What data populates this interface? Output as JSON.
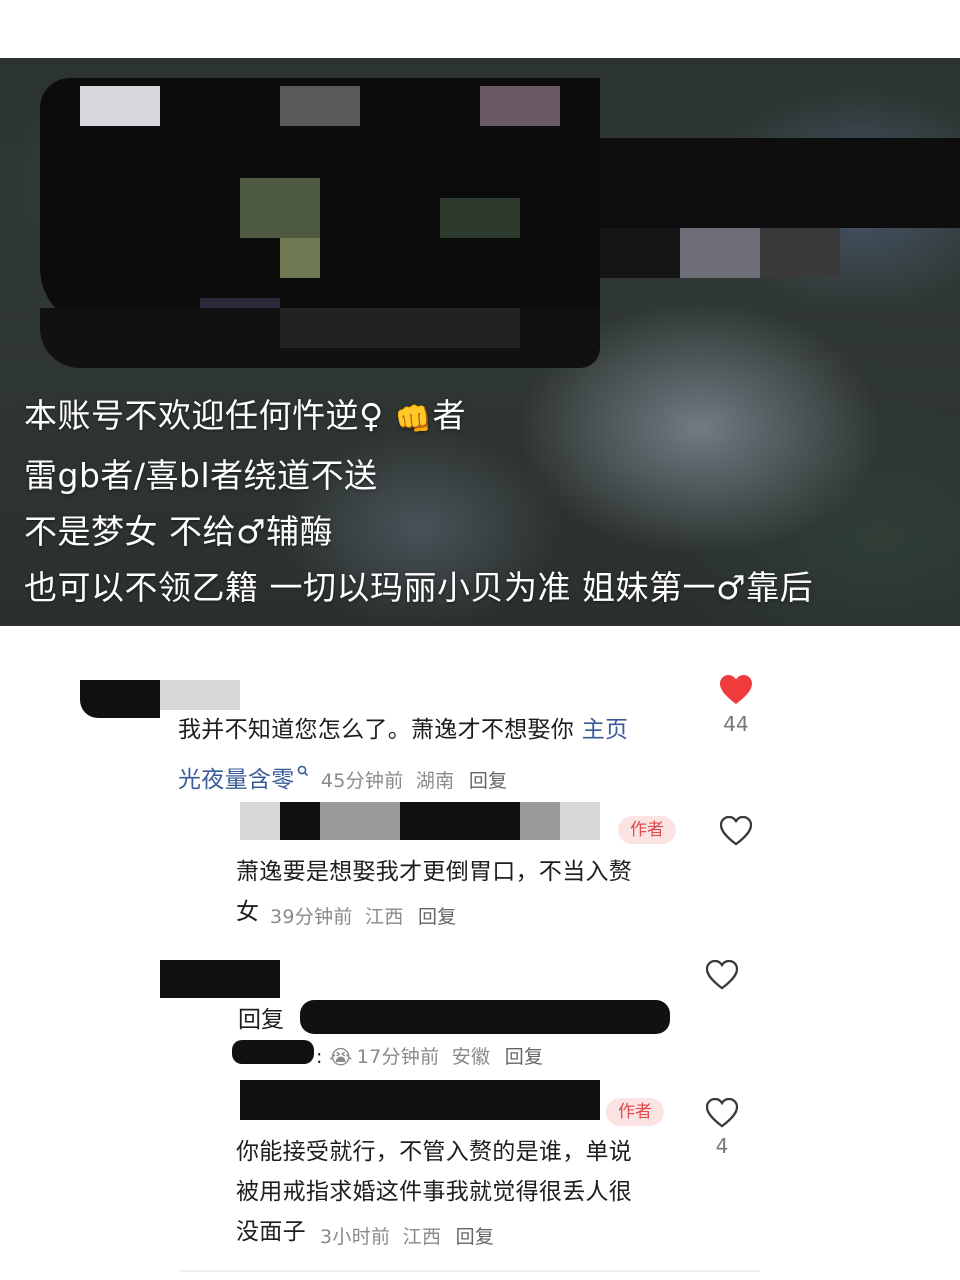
{
  "banner": {
    "lines": [
      "本账号不欢迎任何忤逆♀",
      "者",
      "雷gb者/喜bl者绕道不送",
      "不是梦女 不给♂辅酶",
      "也可以不领乙籍 一切以玛丽小贝为准 姐妹第一♂靠后"
    ],
    "fist_icon": "fist-emoji",
    "fist_glyph": "👊"
  },
  "comments": [
    {
      "text": "我并不知道您怎么了。萧逸才不想娶你 ",
      "link_text": "主页",
      "link_tail": "光夜量含零",
      "link_icon": "search-icon",
      "time": "45分钟前",
      "location": "湖南",
      "reply": "回复",
      "liked": true,
      "like_count": "44",
      "colors": {
        "like": "#ef3b3b"
      }
    },
    {
      "is_author": true,
      "author_badge": "作者",
      "text_line1": "萧逸要是想娶我才更倒胃口，不当入赘",
      "text_line2": "女",
      "time": "39分钟前",
      "location": "江西",
      "reply": "回复",
      "liked": false,
      "like_count": ""
    },
    {
      "reply_prefix": "回复",
      "emoji": "crying-baby-emoji",
      "emoji_glyph": "😭",
      "time": "17分钟前",
      "location": "安徽",
      "reply": "回复",
      "liked": false,
      "like_count": ""
    },
    {
      "is_author": true,
      "author_badge": "作者",
      "text_line1": "你能接受就行，不管入赘的是谁，单说",
      "text_line2": "被用戒指求婚这件事我就觉得很丢人很",
      "text_line3": "没面子",
      "time": "3小时前",
      "location": "江西",
      "reply": "回复",
      "liked": false,
      "like_count": "4"
    }
  ]
}
